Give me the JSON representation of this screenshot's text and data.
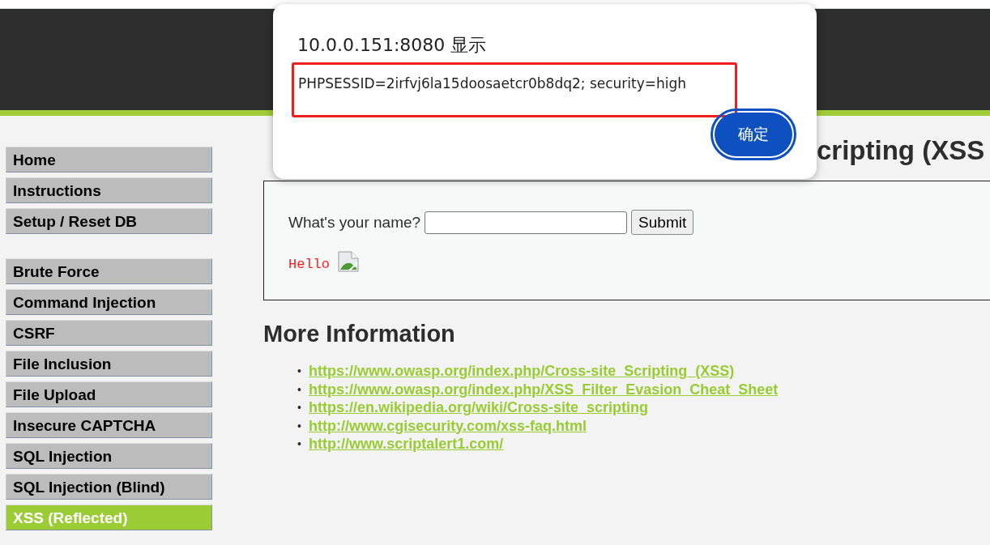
{
  "sidebar": {
    "groups": [
      {
        "items": [
          {
            "label": "Home",
            "selected": false
          },
          {
            "label": "Instructions",
            "selected": false
          },
          {
            "label": "Setup / Reset DB",
            "selected": false
          }
        ]
      },
      {
        "items": [
          {
            "label": "Brute Force",
            "selected": false
          },
          {
            "label": "Command Injection",
            "selected": false
          },
          {
            "label": "CSRF",
            "selected": false
          },
          {
            "label": "File Inclusion",
            "selected": false
          },
          {
            "label": "File Upload",
            "selected": false
          },
          {
            "label": "Insecure CAPTCHA",
            "selected": false
          },
          {
            "label": "SQL Injection",
            "selected": false
          },
          {
            "label": "SQL Injection (Blind)",
            "selected": false
          },
          {
            "label": "XSS (Reflected)",
            "selected": true
          }
        ]
      }
    ]
  },
  "main": {
    "heading_parts": [
      "cripting (XSS"
    ],
    "form": {
      "label": "What's your name?",
      "button": "Submit"
    },
    "output": {
      "text": "Hello",
      "image": {
        "kind": "broken-image"
      }
    },
    "more_info": {
      "heading": "More Information",
      "links": [
        {
          "marker": "•",
          "text": "https://www.owasp.org/index.php/Cross-site_Scripting_(XSS)"
        },
        {
          "marker": "•",
          "text": "https://www.owasp.org/index.php/XSS_Filter_Evasion_Cheat_Sheet"
        },
        {
          "marker": "•",
          "text": "https://en.wikipedia.org/wiki/Cross-site_scripting"
        },
        {
          "marker": "•",
          "text": "http://www.cgisecurity.com/xss-faq.html"
        },
        {
          "marker": "•",
          "text": "http://www.scriptalert1.com/"
        }
      ]
    }
  },
  "dialog": {
    "title": "10.0.0.151:8080 显示",
    "message": "PHPSESSID=2irfvj6la15doosaetcr0b8dq2; security=high",
    "button": "确定"
  }
}
